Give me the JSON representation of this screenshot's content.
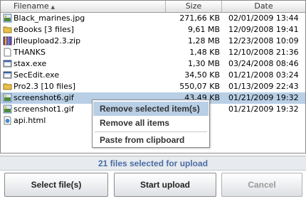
{
  "columns": {
    "name": "Filename",
    "size": "Size",
    "date": "Date"
  },
  "files": [
    {
      "name": "Black_marines.jpg",
      "size": "271,66 KB",
      "date": "02/01/2009 13:44",
      "icon": "image-file-icon"
    },
    {
      "name": "eBooks [3 files]",
      "size": "9,61 MB",
      "date": "12/09/2008 19:41",
      "icon": "folder-icon"
    },
    {
      "name": "jfileupload2.3.zip",
      "size": "1,28 MB",
      "date": "12/23/2008 10:09",
      "icon": "archive-file-icon"
    },
    {
      "name": "THANKS",
      "size": "1,48 KB",
      "date": "12/10/2008 21:36",
      "icon": "generic-file-icon"
    },
    {
      "name": "stax.exe",
      "size": "1,30 MB",
      "date": "03/24/2008 08:46",
      "icon": "executable-file-icon"
    },
    {
      "name": "SecEdit.exe",
      "size": "34,50 KB",
      "date": "01/21/2008 03:24",
      "icon": "executable-file-icon"
    },
    {
      "name": "Pro2.3 [10 files]",
      "size": "550,07 KB",
      "date": "01/13/2009 22:43",
      "icon": "folder-icon"
    },
    {
      "name": "screenshot6.gif",
      "size": "43,49 KB",
      "date": "01/21/2009 19:32",
      "icon": "image-file-icon",
      "selected": true
    },
    {
      "name": "screenshot1.gif",
      "size": "",
      "date": "01/21/2009 19:32",
      "icon": "image-file-icon"
    },
    {
      "name": "api.html",
      "size": "",
      "date": "",
      "icon": "web-file-icon"
    }
  ],
  "context_menu": {
    "items": [
      "Remove selected item(s)",
      "Remove all items",
      "Paste from clipboard"
    ],
    "highlighted_index": 0
  },
  "status": "21 files selected for upload",
  "buttons": {
    "select": "Select file(s)",
    "upload": "Start upload",
    "cancel": "Cancel"
  },
  "colors": {
    "selection": "#b8cfe5",
    "status_text": "#4a6da5",
    "disabled_text": "#9a9a9a"
  }
}
